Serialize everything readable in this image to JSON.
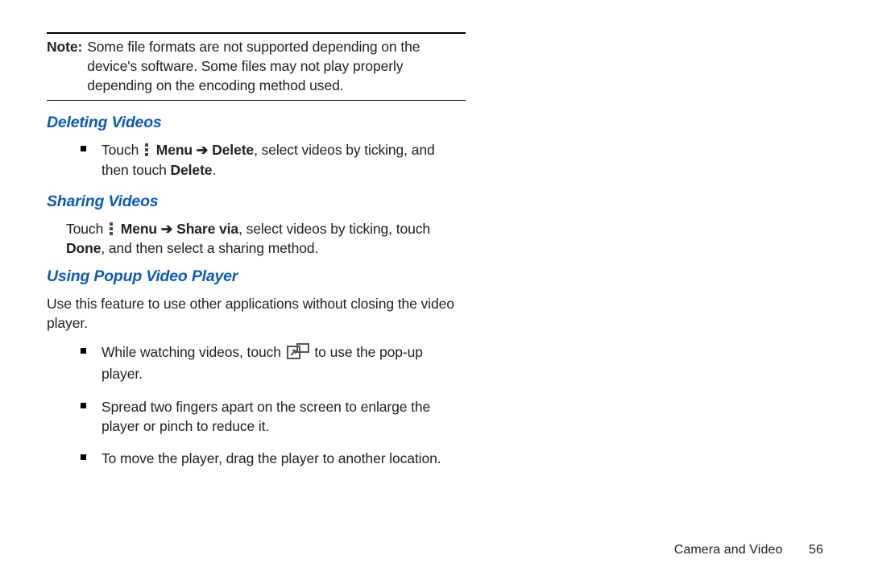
{
  "note": {
    "label": "Note:",
    "body": "Some file formats are not supported depending on the device's software. Some files may not play properly depending on the encoding method used."
  },
  "sections": {
    "deleting": {
      "title": "Deleting Videos",
      "item": {
        "t_touch": "Touch",
        "t_menu": "Menu",
        "t_arrow": "➔",
        "t_delete": "Delete",
        "t_rest": ", select videos by ticking, and then touch ",
        "t_delete2": "Delete",
        "t_period": "."
      }
    },
    "sharing": {
      "title": "Sharing Videos",
      "para": {
        "t_touch": "Touch",
        "t_menu": "Menu",
        "t_arrow": "➔",
        "t_sharevia": "Share via",
        "t_mid": ", select videos by ticking, touch ",
        "t_done": "Done",
        "t_end": ", and then select a sharing method."
      }
    },
    "popup": {
      "title": "Using Popup Video Player",
      "intro": "Use this feature to use other applications without closing the video player.",
      "b1_a": "While watching videos, touch",
      "b1_b": "to use the pop-up player.",
      "b2": "Spread two fingers apart on the screen to enlarge the player or pinch to reduce it.",
      "b3": "To move the player, drag the player to another location."
    }
  },
  "footer": {
    "section": "Camera and Video",
    "page": "56"
  }
}
